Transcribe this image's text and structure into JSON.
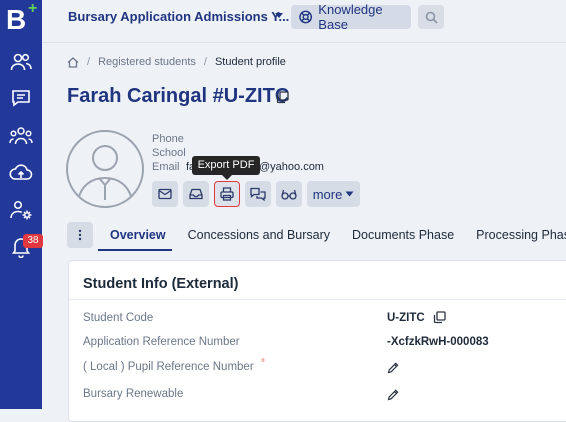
{
  "app": {
    "logo_letter": "B",
    "logo_plus": "+",
    "title": "Bursary Application Admissions Y...",
    "knowledge_base_label": "Knowledge Base"
  },
  "sidebar": {
    "items": [
      {
        "icon": "users-icon"
      },
      {
        "icon": "chat-icon"
      },
      {
        "icon": "group-icon"
      },
      {
        "icon": "cloud-upload-icon"
      },
      {
        "icon": "user-settings-icon"
      },
      {
        "icon": "bell-icon",
        "badge": "38"
      }
    ]
  },
  "breadcrumb": {
    "home_icon": "home-icon",
    "items": [
      "Registered students",
      "Student profile"
    ]
  },
  "profile": {
    "name": "Farah Caringal",
    "code": "#U-ZITC",
    "phone_label": "Phone",
    "school_label": "School",
    "email_label": "Email",
    "email_prefix": "fa",
    "email_suffix": "@yahoo.com"
  },
  "actions": {
    "tooltip": "Export PDF",
    "more_label": "more",
    "buttons": [
      "mail-icon",
      "inbox-icon",
      "printer-icon",
      "chat-icon",
      "glasses-icon"
    ]
  },
  "tabs": [
    "Overview",
    "Concessions and Bursary",
    "Documents Phase",
    "Processing Phase"
  ],
  "card": {
    "title": "Student Info (External)",
    "fields": [
      {
        "label": "Student Code",
        "value": "U-ZITC"
      },
      {
        "label": "Application Reference Number",
        "value": "-XcfzkRwH-000083"
      },
      {
        "label": "( Local ) Pupil Reference Number",
        "value": ""
      },
      {
        "label": "Bursary Renewable",
        "value": ""
      }
    ]
  },
  "colors": {
    "sidebar": "#22399a",
    "accent": "#1f3580",
    "badge": "#e0383e",
    "background": "#eef1f6"
  }
}
